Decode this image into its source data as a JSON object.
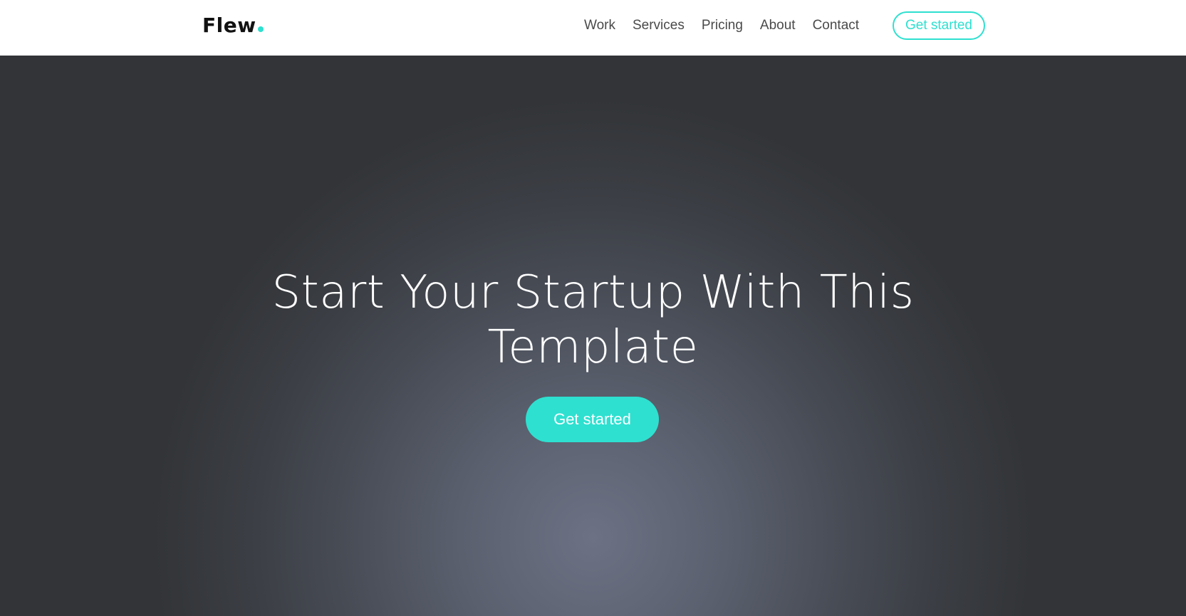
{
  "brand": {
    "name": "Flew",
    "accent_color": "#2ee0d0"
  },
  "nav": {
    "links": [
      "Work",
      "Services",
      "Pricing",
      "About",
      "Contact"
    ],
    "cta_label": "Get started"
  },
  "hero": {
    "title_line1": "Start Your Startup With This",
    "title_line2": "Template",
    "cta_label": "Get started",
    "bg_colors": [
      "#6c7284",
      "#323437"
    ]
  }
}
